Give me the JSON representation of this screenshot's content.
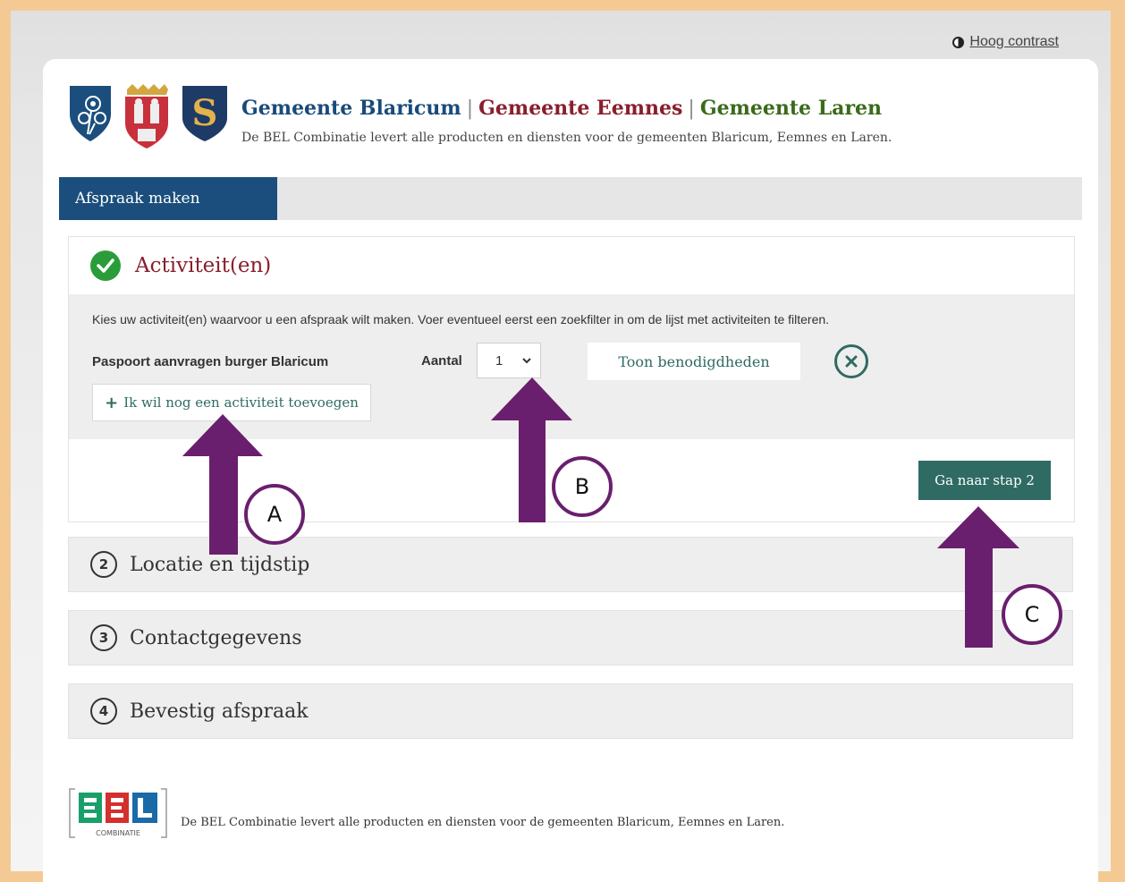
{
  "top": {
    "contrast_label": "Hoog contrast"
  },
  "header": {
    "gemeente_1": "Gemeente Blaricum",
    "gemeente_2": "Gemeente Eemnes",
    "gemeente_3": "Gemeente Laren",
    "separator": "|",
    "tagline": "De BEL Combinatie levert alle producten en diensten voor de gemeenten Blaricum, Eemnes en Laren.",
    "crest_3_letter": "S"
  },
  "tabs": {
    "active_label": "Afspraak maken"
  },
  "step1": {
    "title": "Activiteit(en)",
    "instructions": "Kies uw activiteit(en) waarvoor u een afspraak wilt maken. Voer eventueel eerst een zoekfilter in om de lijst met activiteiten te filteren.",
    "activity_name": "Paspoort aanvragen burger Blaricum",
    "aantal_label": "Aantal",
    "aantal_value": "1",
    "toon_label": "Toon benodigdheden",
    "add_label": "Ik wil nog een activiteit toevoegen",
    "next_label": "Ga naar stap 2"
  },
  "steps": [
    {
      "number": "2",
      "title": "Locatie en tijdstip"
    },
    {
      "number": "3",
      "title": "Contactgegevens"
    },
    {
      "number": "4",
      "title": "Bevestig afspraak"
    }
  ],
  "footer": {
    "logo_caption": "COMBINATIE",
    "text": "De BEL Combinatie levert alle producten en diensten voor de gemeenten Blaricum, Eemnes en Laren."
  },
  "annotations": {
    "a": "A",
    "b": "B",
    "c": "C"
  },
  "colors": {
    "brand_blue": "#1b4e7d",
    "eemnes_red": "#8a1e2c",
    "laren_green": "#3a6a1a",
    "teal_button": "#2f6b63",
    "annotation_purple": "#6a1f6e",
    "success_green": "#2a9d3a"
  }
}
